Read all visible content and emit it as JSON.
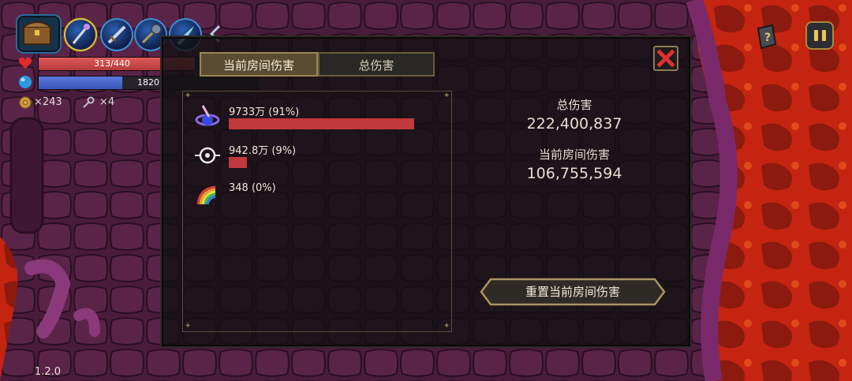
{
  "hud": {
    "hp_text": "313/440",
    "hp_fraction": 0.711,
    "mp_text": "1820",
    "mp_fraction": 0.38,
    "gold": "×243",
    "keys": "×4",
    "skill_icons": [
      "staff-icon",
      "sword-icon",
      "mace-icon",
      "blade-icon"
    ],
    "version": "1.2.0"
  },
  "panel": {
    "tabs": [
      {
        "label": "当前房间伤害",
        "active": true
      },
      {
        "label": "总伤害",
        "active": false
      }
    ],
    "items": [
      {
        "icon": "comet-orb-icon",
        "text": "9733万 (91%)",
        "fraction": 0.91
      },
      {
        "icon": "crosshair-eye-icon",
        "text": "942.8万 (9%)",
        "fraction": 0.09
      },
      {
        "icon": "rainbow-icon",
        "text": "348 (0%)",
        "fraction": 0.0
      }
    ],
    "total_label": "总伤害",
    "total_value": "222,400,837",
    "room_label": "当前房间伤害",
    "room_value": "106,755,594",
    "reset_label": "重置当前房间伤害"
  },
  "colors": {
    "damage_bar": "#c0393c",
    "hp_bar": "#d04848",
    "mp_bar": "#4a66cc",
    "lava": "#d42c10",
    "flesh": "#5a2246"
  }
}
